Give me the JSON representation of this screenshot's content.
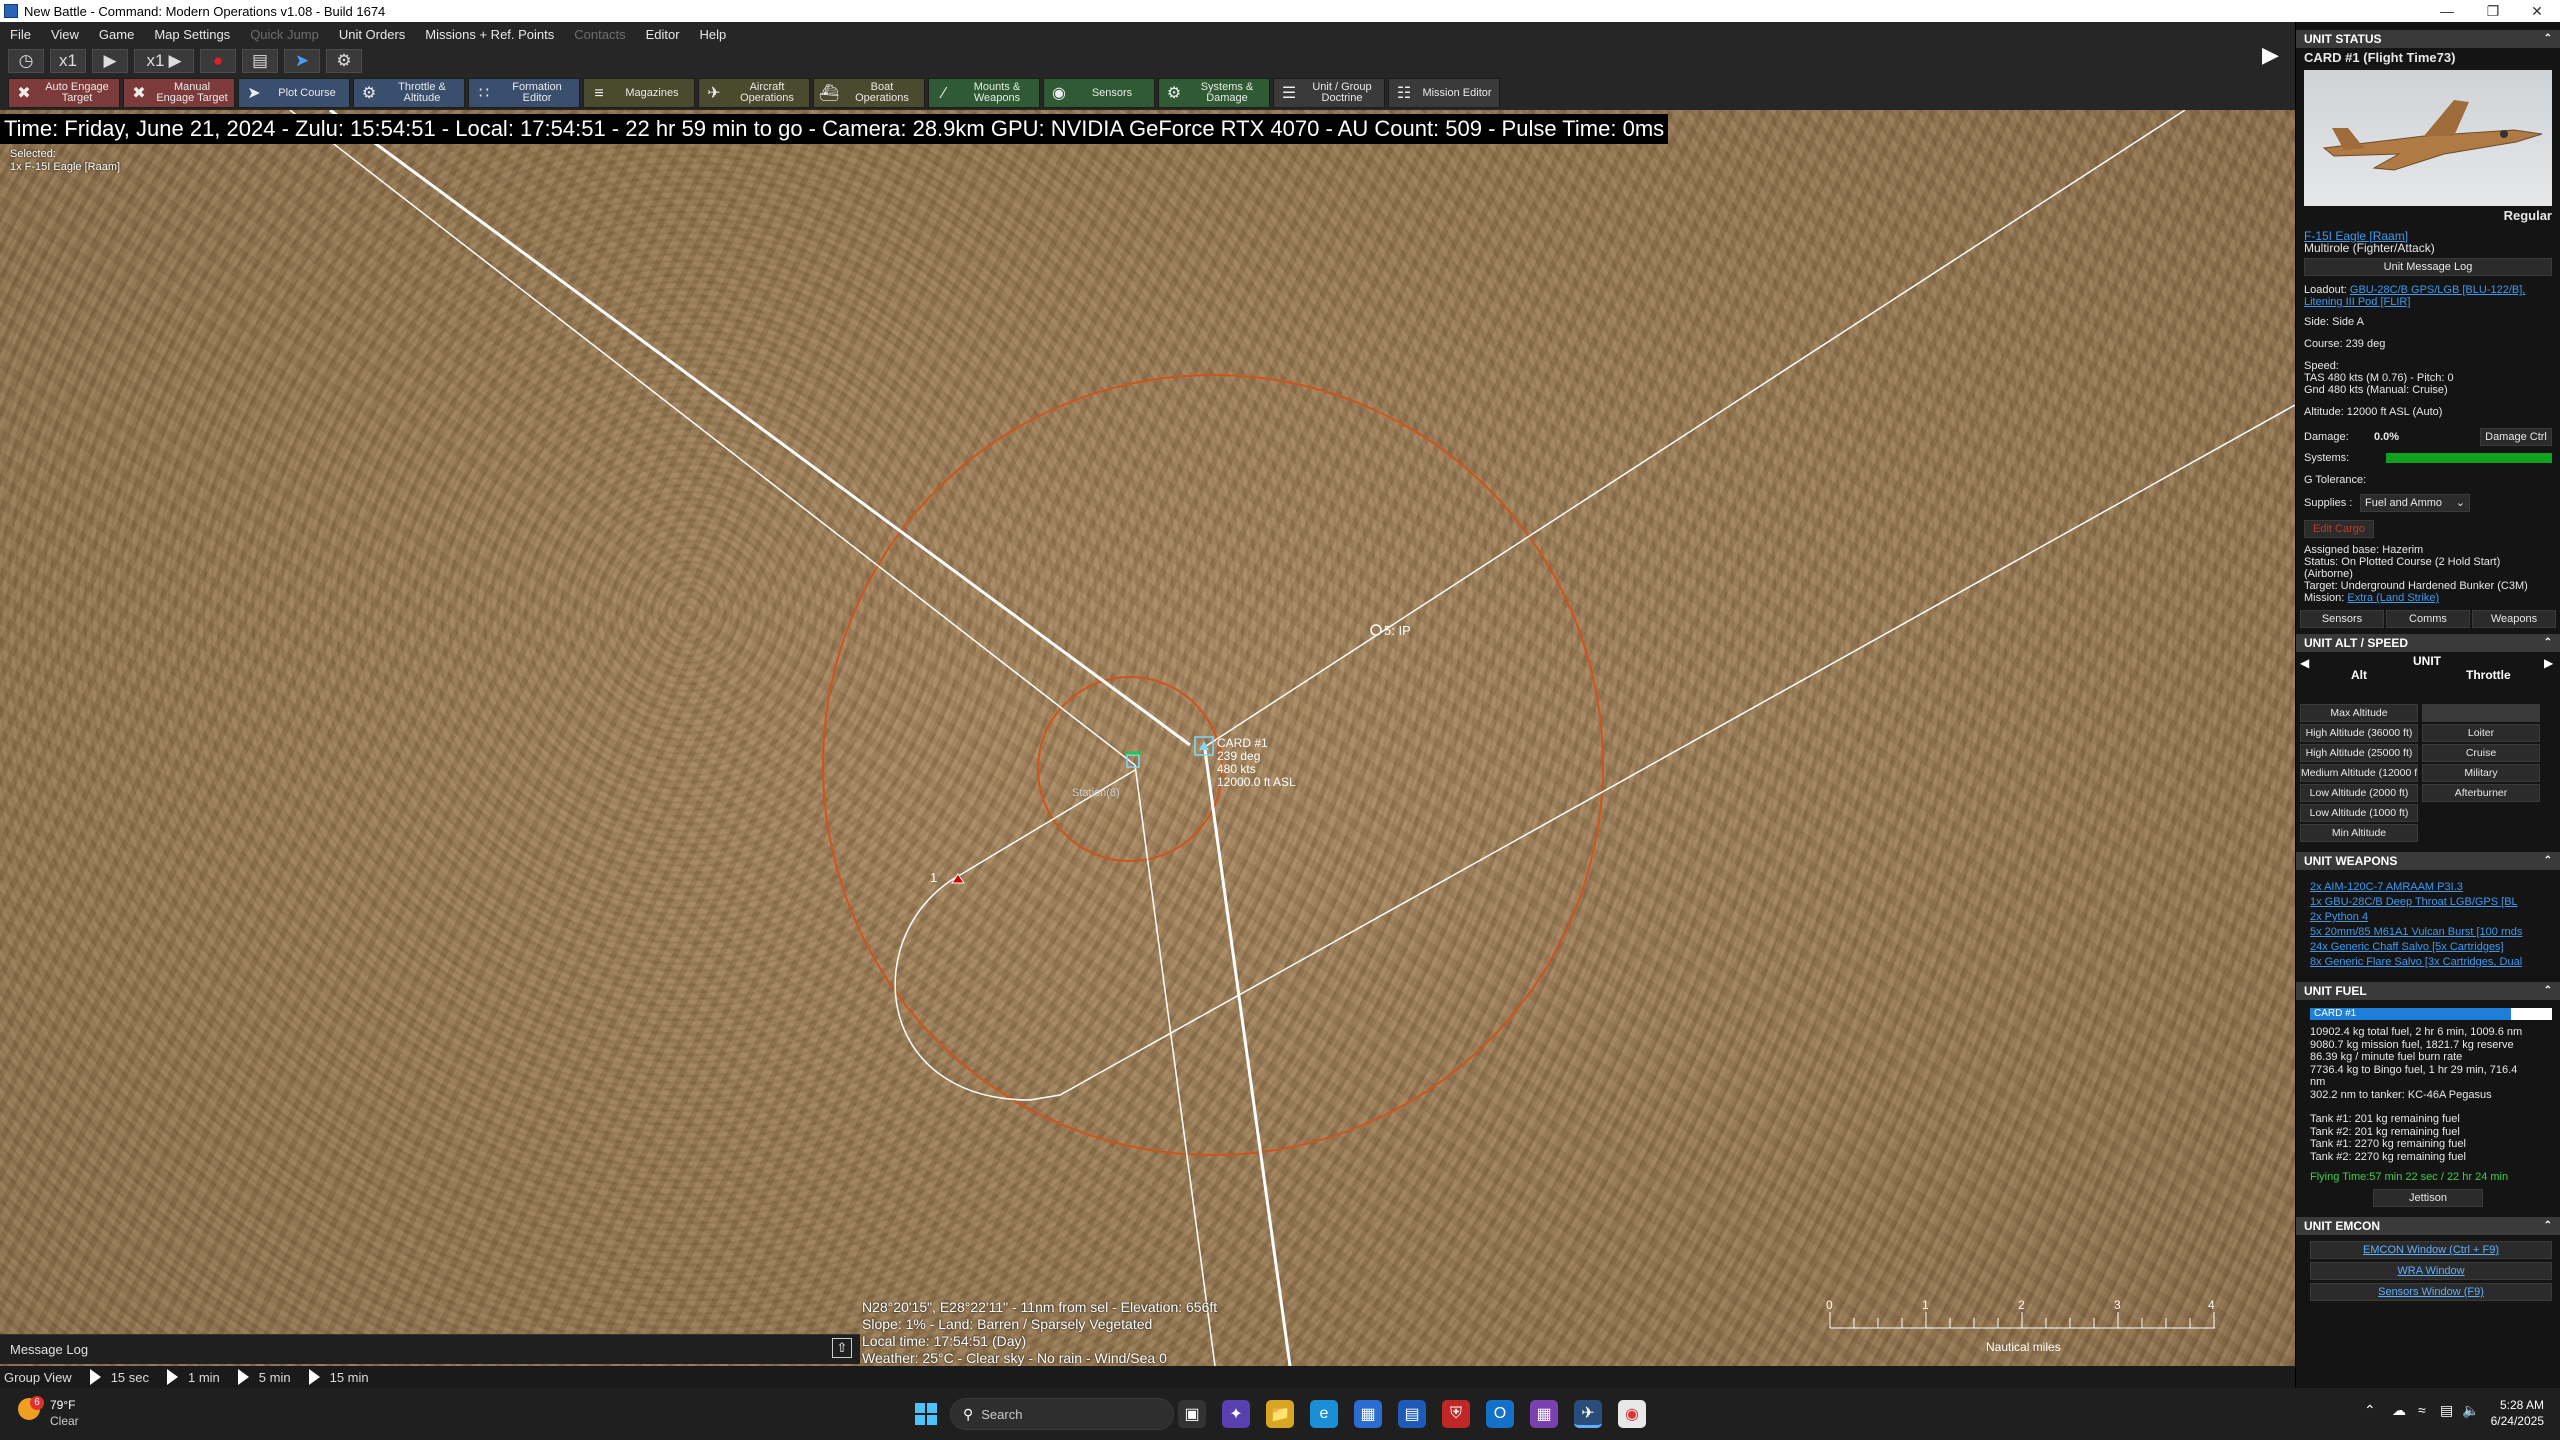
{
  "window": {
    "title": "New Battle - Command: Modern Operations v1.08 - Build 1674"
  },
  "menu": [
    {
      "label": "File",
      "enabled": true
    },
    {
      "label": "View",
      "enabled": true
    },
    {
      "label": "Game",
      "enabled": true
    },
    {
      "label": "Map Settings",
      "enabled": true
    },
    {
      "label": "Quick Jump",
      "enabled": false
    },
    {
      "label": "Unit Orders",
      "enabled": true
    },
    {
      "label": "Missions + Ref. Points",
      "enabled": true
    },
    {
      "label": "Contacts",
      "enabled": false
    },
    {
      "label": "Editor",
      "enabled": true
    },
    {
      "label": "Help",
      "enabled": true
    }
  ],
  "sim": {
    "time_compression_label": "x1",
    "play_speed_label": "x1"
  },
  "toolbar": [
    {
      "label": "Auto Engage Target",
      "icon": "auto-engage-icon",
      "color": "#7d3a3a"
    },
    {
      "label": "Manual Engage Target",
      "icon": "manual-engage-icon",
      "color": "#7d3a3a"
    },
    {
      "label": "Plot Course",
      "icon": "plot-course-icon",
      "color": "#3a4f6d"
    },
    {
      "label": "Throttle & Altitude",
      "icon": "throttle-icon",
      "color": "#3a4f6d"
    },
    {
      "label": "Formation Editor",
      "icon": "formation-icon",
      "color": "#3a4f6d"
    },
    {
      "label": "Magazines",
      "icon": "magazines-icon",
      "color": "#4a4a2e"
    },
    {
      "label": "Aircraft Operations",
      "icon": "aircraft-ops-icon",
      "color": "#4a4a2e"
    },
    {
      "label": "Boat Operations",
      "icon": "boat-ops-icon",
      "color": "#4a4a2e"
    },
    {
      "label": "Mounts & Weapons",
      "icon": "mounts-icon",
      "color": "#2f5a34"
    },
    {
      "label": "Sensors",
      "icon": "sensors-icon",
      "color": "#2f5a34"
    },
    {
      "label": "Systems & Damage",
      "icon": "systems-icon",
      "color": "#2f5a34"
    },
    {
      "label": "Unit / Group Doctrine",
      "icon": "doctrine-icon",
      "color": "#3a3a3a"
    },
    {
      "label": "Mission Editor",
      "icon": "mission-editor-icon",
      "color": "#3a3a3a"
    }
  ],
  "timeline": "Time: Friday, June 21, 2024 - Zulu: 15:54:51 - Local: 17:54:51 - 22 hr 59 min to go - Camera: 28.9km GPU: NVIDIA GeForce RTX 4070 - AU Count: 509 - Pulse Time: 0ms",
  "selected": {
    "label": "Selected:",
    "unit": "1x F-15I Eagle [Raam]"
  },
  "map": {
    "unit_label": [
      "CARD #1",
      "239 deg",
      "480 kts",
      "12000.0 ft ASL"
    ],
    "waypoint_label": "5: IP",
    "station_label": "Station(8)",
    "marker_label": "1",
    "ring_color": "#d0531c",
    "route_color": "#ffffff"
  },
  "cursor_info": [
    "N28°20'15\", E28°22'11\" - 11nm from sel - Elevation: 656ft",
    "Slope: 1% - Land: Barren / Sparsely Vegetated",
    "Local time: 17:54:51 (Day)",
    "Weather: 25°C - Clear sky - No rain - Wind/Sea 0"
  ],
  "scale": {
    "ticks": [
      "0",
      "1",
      "2",
      "3",
      "4"
    ],
    "unit": "Nautical miles"
  },
  "message_log": "Message Log",
  "group_view": {
    "label": "Group View",
    "steps": [
      "15 sec",
      "1 min",
      "5 min",
      "15 min"
    ]
  },
  "panel": {
    "unit_status": {
      "header": "UNIT STATUS",
      "name": "CARD #1 (Flight Time73)",
      "proficiency": "Regular",
      "class_link": "F-15I Eagle [Raam]",
      "role": "Multirole (Fighter/Attack)",
      "message_log_button": "Unit Message Log",
      "loadout_label": "Loadout:",
      "loadout_value": "GBU-28C/B GPS/LGB [BLU-122/B], Litening III Pod [FLIR]",
      "side": "Side: Side A",
      "course": "Course: 239 deg",
      "speed_label": "Speed:",
      "speed_tas": "TAS 480 kts (M 0.76) - Pitch: 0",
      "speed_gnd": "Gnd 480 kts (Manual: Cruise)",
      "altitude": "Altitude: 12000 ft ASL (Auto)",
      "damage_label": "Damage:",
      "damage_value": "0.0%",
      "damage_button": "Damage Ctrl",
      "systems_label": "Systems:",
      "systems_health": 1.0,
      "g_tolerance": "G Tolerance:",
      "supplies_label": "Supplies :",
      "supplies_value": "Fuel and Ammo",
      "edit_cargo": "Edit Cargo",
      "assigned_base": "Assigned base: Hazerim",
      "status": "Status: On Plotted Course (2 Hold Start) (Airborne)",
      "target": "Target: Underground Hardened Bunker (C3M)",
      "mission_label": "Mission:",
      "mission_value": "Extra (Land Strike)",
      "tabs": [
        "Sensors",
        "Comms",
        "Weapons"
      ]
    },
    "alt_speed": {
      "header": "UNIT ALT / SPEED",
      "unit_label": "UNIT",
      "alt_col": "Alt",
      "throttle_col": "Throttle",
      "alt_buttons": [
        "Max Altitude",
        "High Altitude (36000 ft)",
        "High Altitude (25000 ft)",
        "Medium Altitude (12000 ft)",
        "Low Altitude (2000 ft)",
        "Low Altitude (1000 ft)",
        "Min Altitude"
      ],
      "throttle_buttons": [
        "Loiter",
        "Cruise",
        "Military",
        "Afterburner"
      ]
    },
    "weapons": {
      "header": "UNIT WEAPONS",
      "items": [
        "2x AIM-120C-7 AMRAAM P3I.3",
        "1x GBU-28C/B Deep Throat LGB/GPS [BL",
        "2x Python 4",
        "5x 20mm/85 M61A1 Vulcan Burst [100 rnds",
        "24x Generic Chaff Salvo [5x Cartridges]",
        "8x Generic Flare Salvo [3x Cartridges, Dual"
      ]
    },
    "fuel": {
      "header": "UNIT FUEL",
      "bar_label": "CARD #1",
      "fuel_fraction": 0.83,
      "lines": [
        "10902.4 kg total fuel, 2 hr 6 min, 1009.6 nm",
        "9080.7 kg mission fuel, 1821.7 kg reserve",
        "86.39 kg / minute fuel burn rate",
        "7736.4 kg to Bingo fuel, 1 hr 29 min, 716.4",
        "nm",
        "302.2 nm to tanker: KC-46A Pegasus",
        "",
        "Tank #1: 201 kg remaining fuel",
        "Tank #2: 201 kg remaining fuel",
        "Tank #1: 2270 kg remaining fuel",
        "Tank #2: 2270 kg remaining fuel"
      ],
      "flying_time": "Flying Time:57 min 22 sec / 22 hr 24 min",
      "jettison": "Jettison"
    },
    "emcon": {
      "header": "UNIT EMCON",
      "buttons": [
        "EMCON Window (Ctrl + F9)",
        "WRA Window",
        "Sensors Window (F9)"
      ]
    }
  },
  "taskbar": {
    "weather_temp": "79°F",
    "weather_desc": "Clear",
    "weather_badge": "6",
    "search_placeholder": "Search",
    "clock_time": "5:28 AM",
    "clock_date": "6/24/2025"
  }
}
